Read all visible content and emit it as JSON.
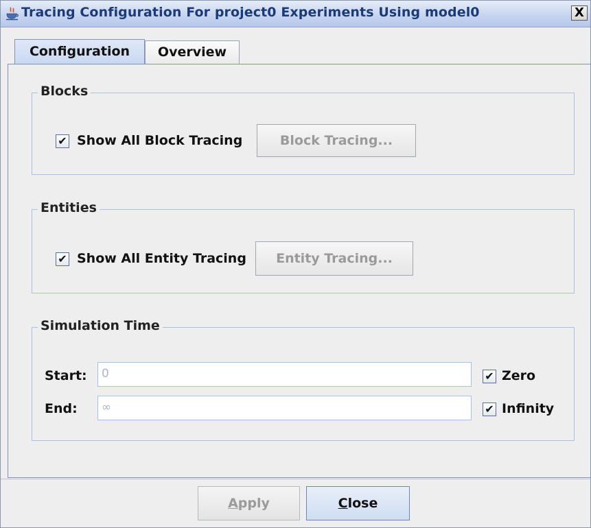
{
  "window": {
    "title": "Tracing Configuration For project0 Experiments Using model0",
    "close_glyph": "X",
    "app_icon": "java-cup-icon"
  },
  "tabs": [
    {
      "label": "Configuration",
      "selected": true
    },
    {
      "label": "Overview",
      "selected": false
    }
  ],
  "blocks": {
    "title": "Blocks",
    "checkbox_label": "Show All Block Tracing",
    "checked": true,
    "button_label": "Block Tracing...",
    "button_enabled": false
  },
  "entities": {
    "title": "Entities",
    "checkbox_label": "Show All Entity Tracing",
    "checked": true,
    "button_label": "Entity Tracing...",
    "button_enabled": false
  },
  "simulation_time": {
    "title": "Simulation Time",
    "start_label": "Start:",
    "start_value": "0",
    "zero_label": "Zero",
    "zero_checked": true,
    "end_label": "End:",
    "end_value": "∞",
    "infinity_label": "Infinity",
    "infinity_checked": true
  },
  "footer": {
    "apply_first": "A",
    "apply_rest": "pply",
    "apply_enabled": false,
    "close_first": "C",
    "close_rest": "lose"
  },
  "colors": {
    "title_text": "#1a3a7a",
    "group_border": "#a9c0df",
    "disabled_text": "#9a9a9a"
  }
}
